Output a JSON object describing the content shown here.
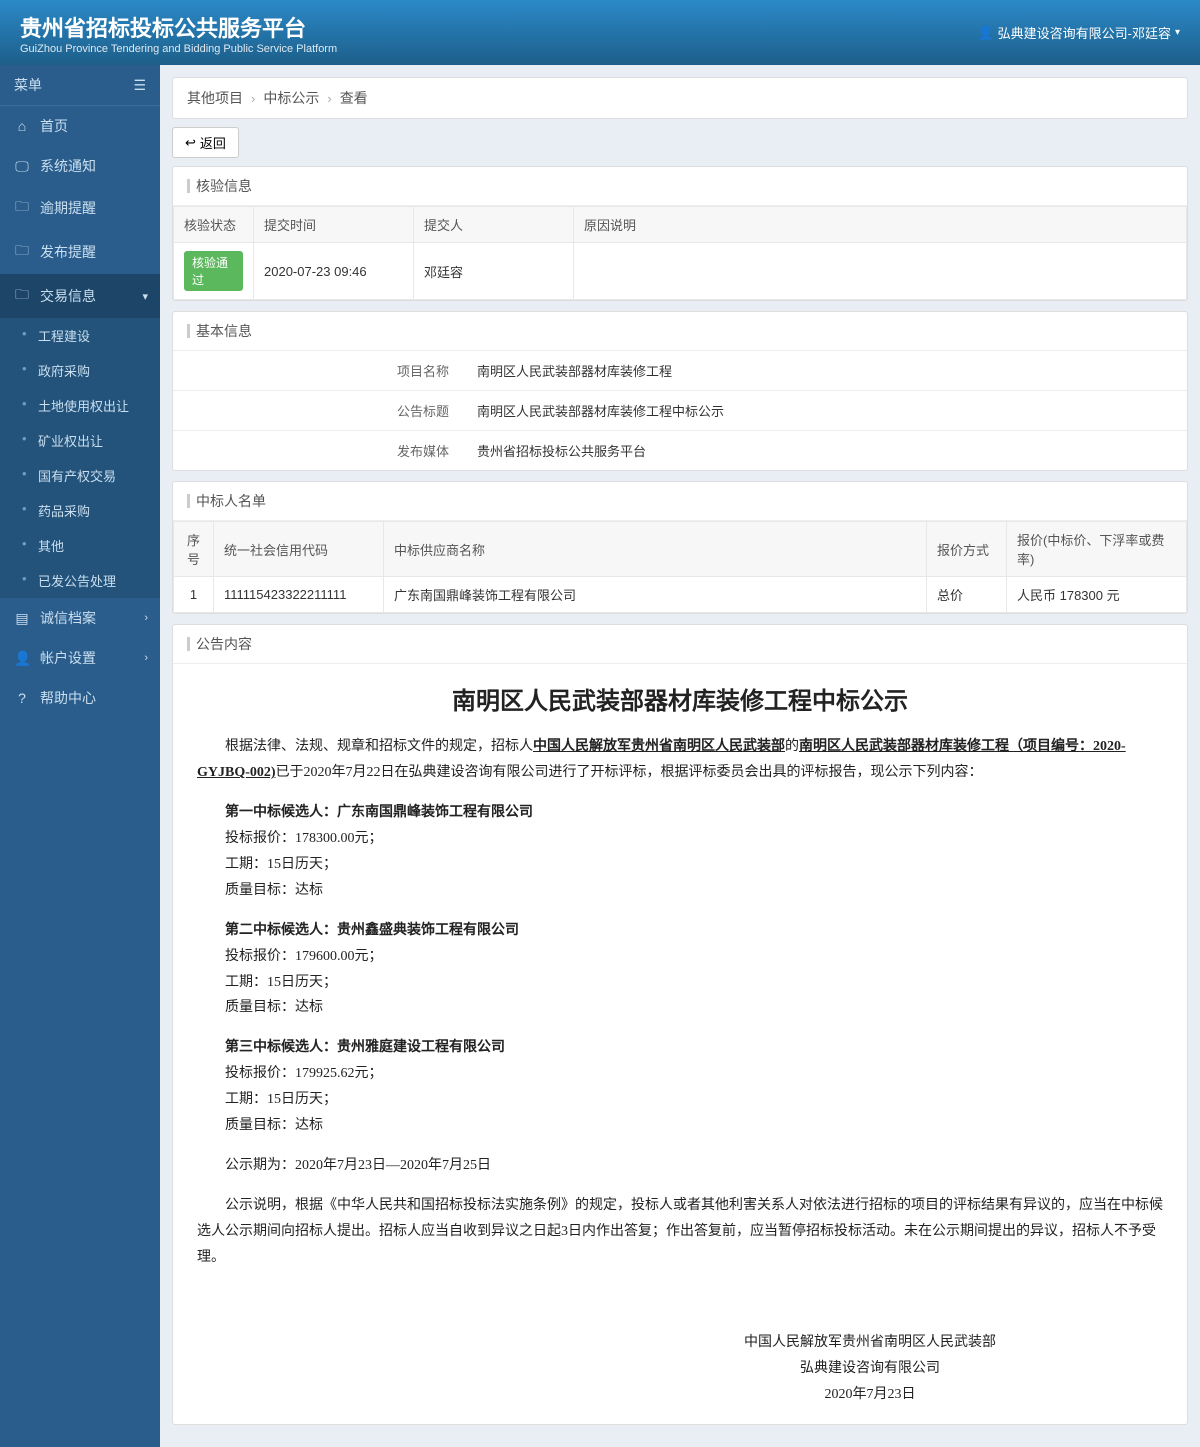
{
  "header": {
    "title": "贵州省招标投标公共服务平台",
    "subtitle": "GuiZhou Province Tendering and Bidding Public Service Platform",
    "user": "弘典建设咨询有限公司-邓廷容"
  },
  "sidebar": {
    "menu_label": "菜单",
    "items": [
      {
        "icon": "⌂",
        "label": "首页"
      },
      {
        "icon": "🖵",
        "label": "系统通知"
      },
      {
        "icon": "🗀",
        "label": "逾期提醒"
      },
      {
        "icon": "🗀",
        "label": "发布提醒"
      },
      {
        "icon": "🗀",
        "label": "交易信息",
        "active": true,
        "chev": "▾"
      }
    ],
    "sub": [
      "工程建设",
      "政府采购",
      "土地使用权出让",
      "矿业权出让",
      "国有产权交易",
      "药品采购",
      "其他",
      "已发公告处理"
    ],
    "items2": [
      {
        "icon": "▤",
        "label": "诚信档案",
        "chev": "›"
      },
      {
        "icon": "👤",
        "label": "帐户设置",
        "chev": "›"
      },
      {
        "icon": "?",
        "label": "帮助中心"
      }
    ]
  },
  "breadcrumb": [
    "其他项目",
    "中标公示",
    "查看"
  ],
  "back_label": "返回",
  "panels": {
    "verify": {
      "title": "核验信息",
      "headers": [
        "核验状态",
        "提交时间",
        "提交人",
        "原因说明"
      ],
      "row": {
        "status": "核验通过",
        "time": "2020-07-23 09:46",
        "person": "邓廷容",
        "reason": ""
      }
    },
    "basic": {
      "title": "基本信息",
      "rows": [
        {
          "label": "项目名称",
          "value": "南明区人民武装部器材库装修工程"
        },
        {
          "label": "公告标题",
          "value": "南明区人民武装部器材库装修工程中标公示"
        },
        {
          "label": "发布媒体",
          "value": "贵州省招标投标公共服务平台"
        }
      ]
    },
    "winners": {
      "title": "中标人名单",
      "headers": [
        "序号",
        "统一社会信用代码",
        "中标供应商名称",
        "报价方式",
        "报价(中标价、下浮率或费率)"
      ],
      "row": {
        "no": "1",
        "code": "111115423322211111",
        "name": "广东南国鼎峰装饰工程有限公司",
        "method": "总价",
        "price": "人民币 178300 元"
      }
    },
    "content": {
      "title": "公告内容",
      "heading": "南明区人民武装部器材库装修工程中标公示",
      "intro_pre": "根据法律、法规、规章和招标文件的规定，招标人",
      "intro_owner": "中国人民解放军贵州省南明区人民武装部",
      "intro_mid": "的",
      "intro_proj": "南明区人民武装部器材库装修工程（项目编号：2020-GYJBQ-002)",
      "intro_post": "已于2020年7月22日在弘典建设咨询有限公司进行了开标评标，根据评标委员会出具的评标报告，现公示下列内容：",
      "cands": [
        {
          "title": "第一中标候选人：广东南国鼎峰装饰工程有限公司",
          "price": "投标报价：178300.00元；",
          "dur": "工期：15日历天；",
          "qual": "质量目标：达标"
        },
        {
          "title": "第二中标候选人：贵州鑫盛典装饰工程有限公司",
          "price": "投标报价：179600.00元；",
          "dur": "工期：15日历天；",
          "qual": "质量目标：达标"
        },
        {
          "title": "第三中标候选人：贵州雅庭建设工程有限公司",
          "price": "投标报价：179925.62元；",
          "dur": "工期：15日历天；",
          "qual": "质量目标：达标"
        }
      ],
      "period": "公示期为：2020年7月23日—2020年7月25日",
      "note": "公示说明，根据《中华人民共和国招标投标法实施条例》的规定，投标人或者其他利害关系人对依法进行招标的项目的评标结果有异议的，应当在中标候选人公示期间向招标人提出。招标人应当自收到异议之日起3日内作出答复；作出答复前，应当暂停招标投标活动。未在公示期间提出的异议，招标人不予受理。",
      "sig1": "中国人民解放军贵州省南明区人民武装部",
      "sig2": "弘典建设咨询有限公司",
      "sig3": "2020年7月23日"
    }
  }
}
